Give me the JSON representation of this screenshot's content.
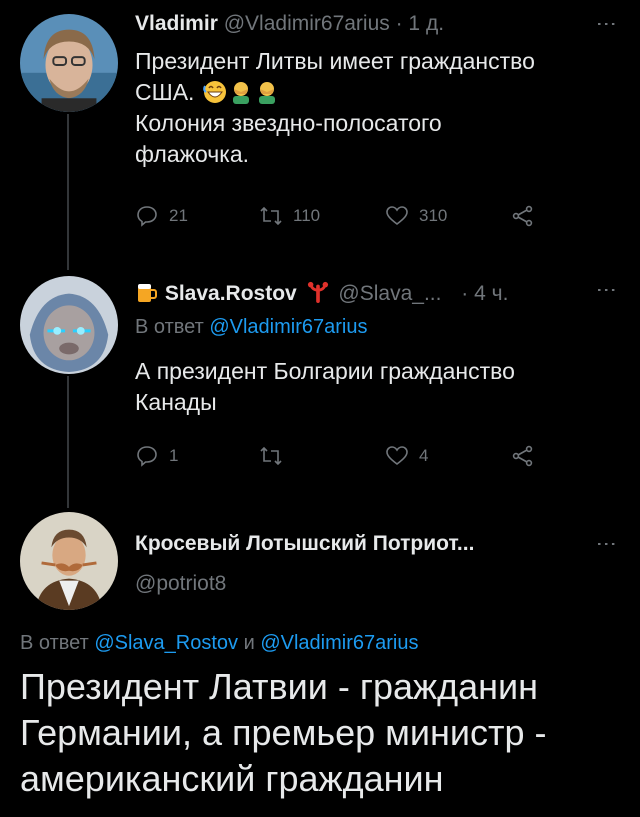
{
  "tweets": [
    {
      "display_name": "Vladimir",
      "handle": "@Vladimir67arius",
      "time": "· 1 д.",
      "text_line1": "Президент Литвы имеет гражданство",
      "text_line2": "США.",
      "text_line3": "Колония звездно-полосатого",
      "text_line4": "флажочка.",
      "actions": {
        "replies": "21",
        "retweets": "110",
        "likes": "310"
      }
    },
    {
      "display_name": "Slava.Rostov",
      "handle": "@Slava_...",
      "time": "· 4 ч.",
      "reply_label": "В ответ",
      "reply_handle": "@Vladimir67arius",
      "text_line1": "А президент Болгарии гражданство",
      "text_line2": "Канады",
      "actions": {
        "replies": "1",
        "retweets": "",
        "likes": "4"
      }
    },
    {
      "display_name": "Кросевый Лотышский Потриот...",
      "handle": "@potriot8",
      "reply_label": "В ответ",
      "reply_handle1": "@Slava_Rostov",
      "reply_and": "и",
      "reply_handle2": "@Vladimir67arius",
      "text_line1": "Президент Латвии - гражданин",
      "text_line2": "Германии, а премьер министр -",
      "text_line3": "американский гражданин"
    }
  ],
  "icons": [
    "reply-icon",
    "retweet-icon",
    "like-icon",
    "share-icon",
    "more-icon",
    "beer-icon",
    "lobster-icon",
    "grinning-emoji",
    "facepalm-emoji"
  ],
  "colors": {
    "background": "#000000",
    "text": "#e7e9ea",
    "muted": "#71767b",
    "link": "#1d9bf0",
    "thread": "#333639"
  }
}
